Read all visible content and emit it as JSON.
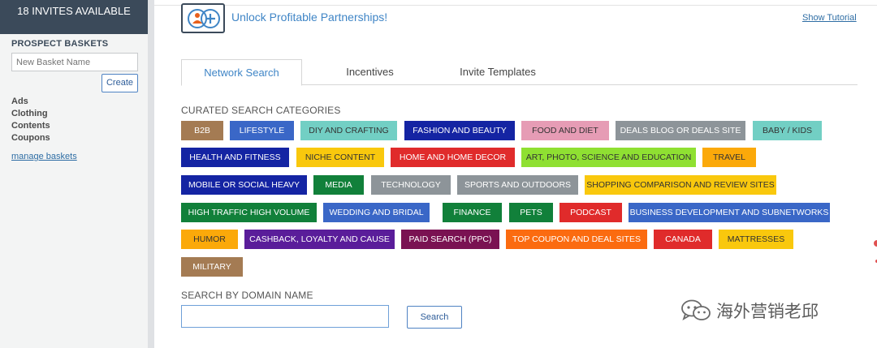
{
  "sidebar": {
    "invites_banner": "18 INVITES AVAILABLE",
    "title": "PROSPECT BASKETS",
    "basket_placeholder": "New Basket Name",
    "create_label": "Create",
    "baskets": [
      "Ads",
      "Clothing",
      "Contents",
      "Coupons"
    ],
    "manage_label": "manage baskets"
  },
  "header": {
    "headline": "Unlock Profitable Partnerships!",
    "tutorial_label": "Show Tutorial"
  },
  "tabs": [
    "Network Search",
    "Incentives",
    "Invite Templates"
  ],
  "categories_label": "CURATED SEARCH CATEGORIES",
  "categories": [
    {
      "label": "B2B",
      "bg": "#a47b53",
      "fg": "#ffffff"
    },
    {
      "label": "LIFESTYLE",
      "bg": "#3a67c7",
      "fg": "#ffffff"
    },
    {
      "label": "DIY AND CRAFTING",
      "bg": "#72cfc4",
      "fg": "#333333"
    },
    {
      "label": "FASHION AND BEAUTY",
      "bg": "#1424a3",
      "fg": "#ffffff"
    },
    {
      "label": "FOOD AND DIET",
      "bg": "#e69cb5",
      "fg": "#333333"
    },
    {
      "label": "DEALS BLOG OR DEALS SITE",
      "bg": "#8d9499",
      "fg": "#ffffff"
    },
    {
      "label": "BABY / KIDS",
      "bg": "#72cfc4",
      "fg": "#333333"
    },
    {
      "label": "HEALTH AND FITNESS",
      "bg": "#1424a3",
      "fg": "#ffffff"
    },
    {
      "label": "NICHE CONTENT",
      "bg": "#f9c80d",
      "fg": "#333333"
    },
    {
      "label": "HOME AND HOME DECOR",
      "bg": "#e02b2b",
      "fg": "#ffffff"
    },
    {
      "label": "ART, PHOTO, SCIENCE AND EDUCATION",
      "bg": "#8fe032",
      "fg": "#333333"
    },
    {
      "label": "TRAVEL",
      "bg": "#fba90a",
      "fg": "#333333"
    },
    {
      "label": "MOBILE OR SOCIAL HEAVY",
      "bg": "#1424a3",
      "fg": "#ffffff"
    },
    {
      "label": "MEDIA",
      "bg": "#11803a",
      "fg": "#ffffff"
    },
    {
      "label": "TECHNOLOGY",
      "bg": "#8d9499",
      "fg": "#ffffff"
    },
    {
      "label": "SPORTS AND OUTDOORS",
      "bg": "#8d9499",
      "fg": "#ffffff"
    },
    {
      "label": "SHOPPING COMPARISON AND REVIEW SITES",
      "bg": "#f9c80d",
      "fg": "#333333"
    },
    {
      "label": "HIGH TRAFFIC HIGH VOLUME",
      "bg": "#11803a",
      "fg": "#ffffff"
    },
    {
      "label": "WEDDING AND BRIDAL",
      "bg": "#3a67c7",
      "fg": "#ffffff"
    },
    {
      "label": "FINANCE",
      "bg": "#11803a",
      "fg": "#ffffff"
    },
    {
      "label": "PETS",
      "bg": "#11803a",
      "fg": "#ffffff"
    },
    {
      "label": "PODCAST",
      "bg": "#e02b2b",
      "fg": "#ffffff"
    },
    {
      "label": "BUSINESS DEVELOPMENT AND SUBNETWORKS",
      "bg": "#3a67c7",
      "fg": "#ffffff"
    },
    {
      "label": "HUMOR",
      "bg": "#fba90a",
      "fg": "#333333"
    },
    {
      "label": "CASHBACK, LOYALTY AND CAUSE",
      "bg": "#5a1d9a",
      "fg": "#ffffff"
    },
    {
      "label": "PAID SEARCH (PPC)",
      "bg": "#7a1252",
      "fg": "#ffffff"
    },
    {
      "label": "TOP COUPON AND DEAL SITES",
      "bg": "#fb6b10",
      "fg": "#ffffff"
    },
    {
      "label": "CANADA",
      "bg": "#e02b2b",
      "fg": "#ffffff"
    },
    {
      "label": "MATTRESSES",
      "bg": "#f9c80d",
      "fg": "#333333"
    },
    {
      "label": "MILITARY",
      "bg": "#a47b53",
      "fg": "#ffffff"
    }
  ],
  "domain_search": {
    "label": "SEARCH BY DOMAIN NAME",
    "input_value": "",
    "button_label": "Search"
  },
  "watermark": {
    "text": "海外营销老邱",
    "icon": "wechat-icon"
  },
  "colors": {
    "banner_bg": "#3b4a5a",
    "accent_blue": "#3f85c6",
    "sidebar_bg": "#f3f4f4"
  }
}
